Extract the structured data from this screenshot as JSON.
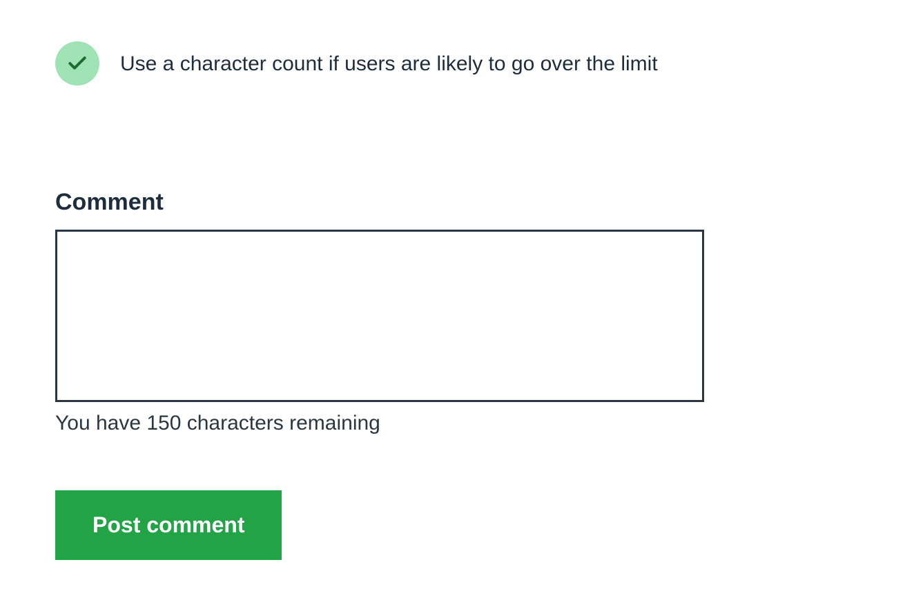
{
  "tip": {
    "text": "Use a character count if users are likely to go over the limit"
  },
  "form": {
    "comment_label": "Comment",
    "comment_value": "",
    "remaining_text": "You have 150 characters remaining",
    "submit_label": "Post comment"
  }
}
